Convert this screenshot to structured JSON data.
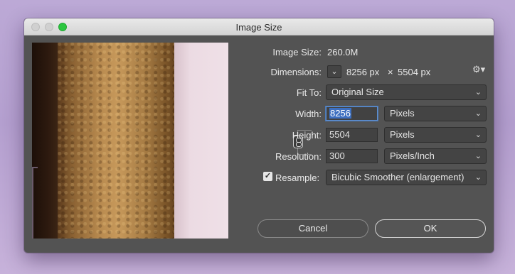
{
  "window": {
    "title": "Image Size"
  },
  "info": {
    "image_size_label": "Image Size:",
    "image_size_value": "260.0M",
    "dimensions_label": "Dimensions:",
    "dim_width": "8256 px",
    "dim_times": "×",
    "dim_height": "5504 px"
  },
  "fit_to": {
    "label": "Fit To:",
    "value": "Original Size"
  },
  "width": {
    "label": "Width:",
    "value": "8256",
    "unit": "Pixels"
  },
  "height": {
    "label": "Height:",
    "value": "5504",
    "unit": "Pixels"
  },
  "resolution": {
    "label": "Resolution:",
    "value": "300",
    "unit": "Pixels/Inch"
  },
  "resample": {
    "label": "Resample:",
    "checked": true,
    "value": "Bicubic Smoother (enlargement)"
  },
  "buttons": {
    "cancel": "Cancel",
    "ok": "OK"
  },
  "icons": {
    "gear": "gear-icon",
    "chevron": "chevron-down-icon",
    "link": "link-icon",
    "checkmark": "checkmark-icon"
  },
  "colors": {
    "dialog_bg": "#535353",
    "focus": "#4a79b8",
    "zoom_button": "#2cc640"
  }
}
